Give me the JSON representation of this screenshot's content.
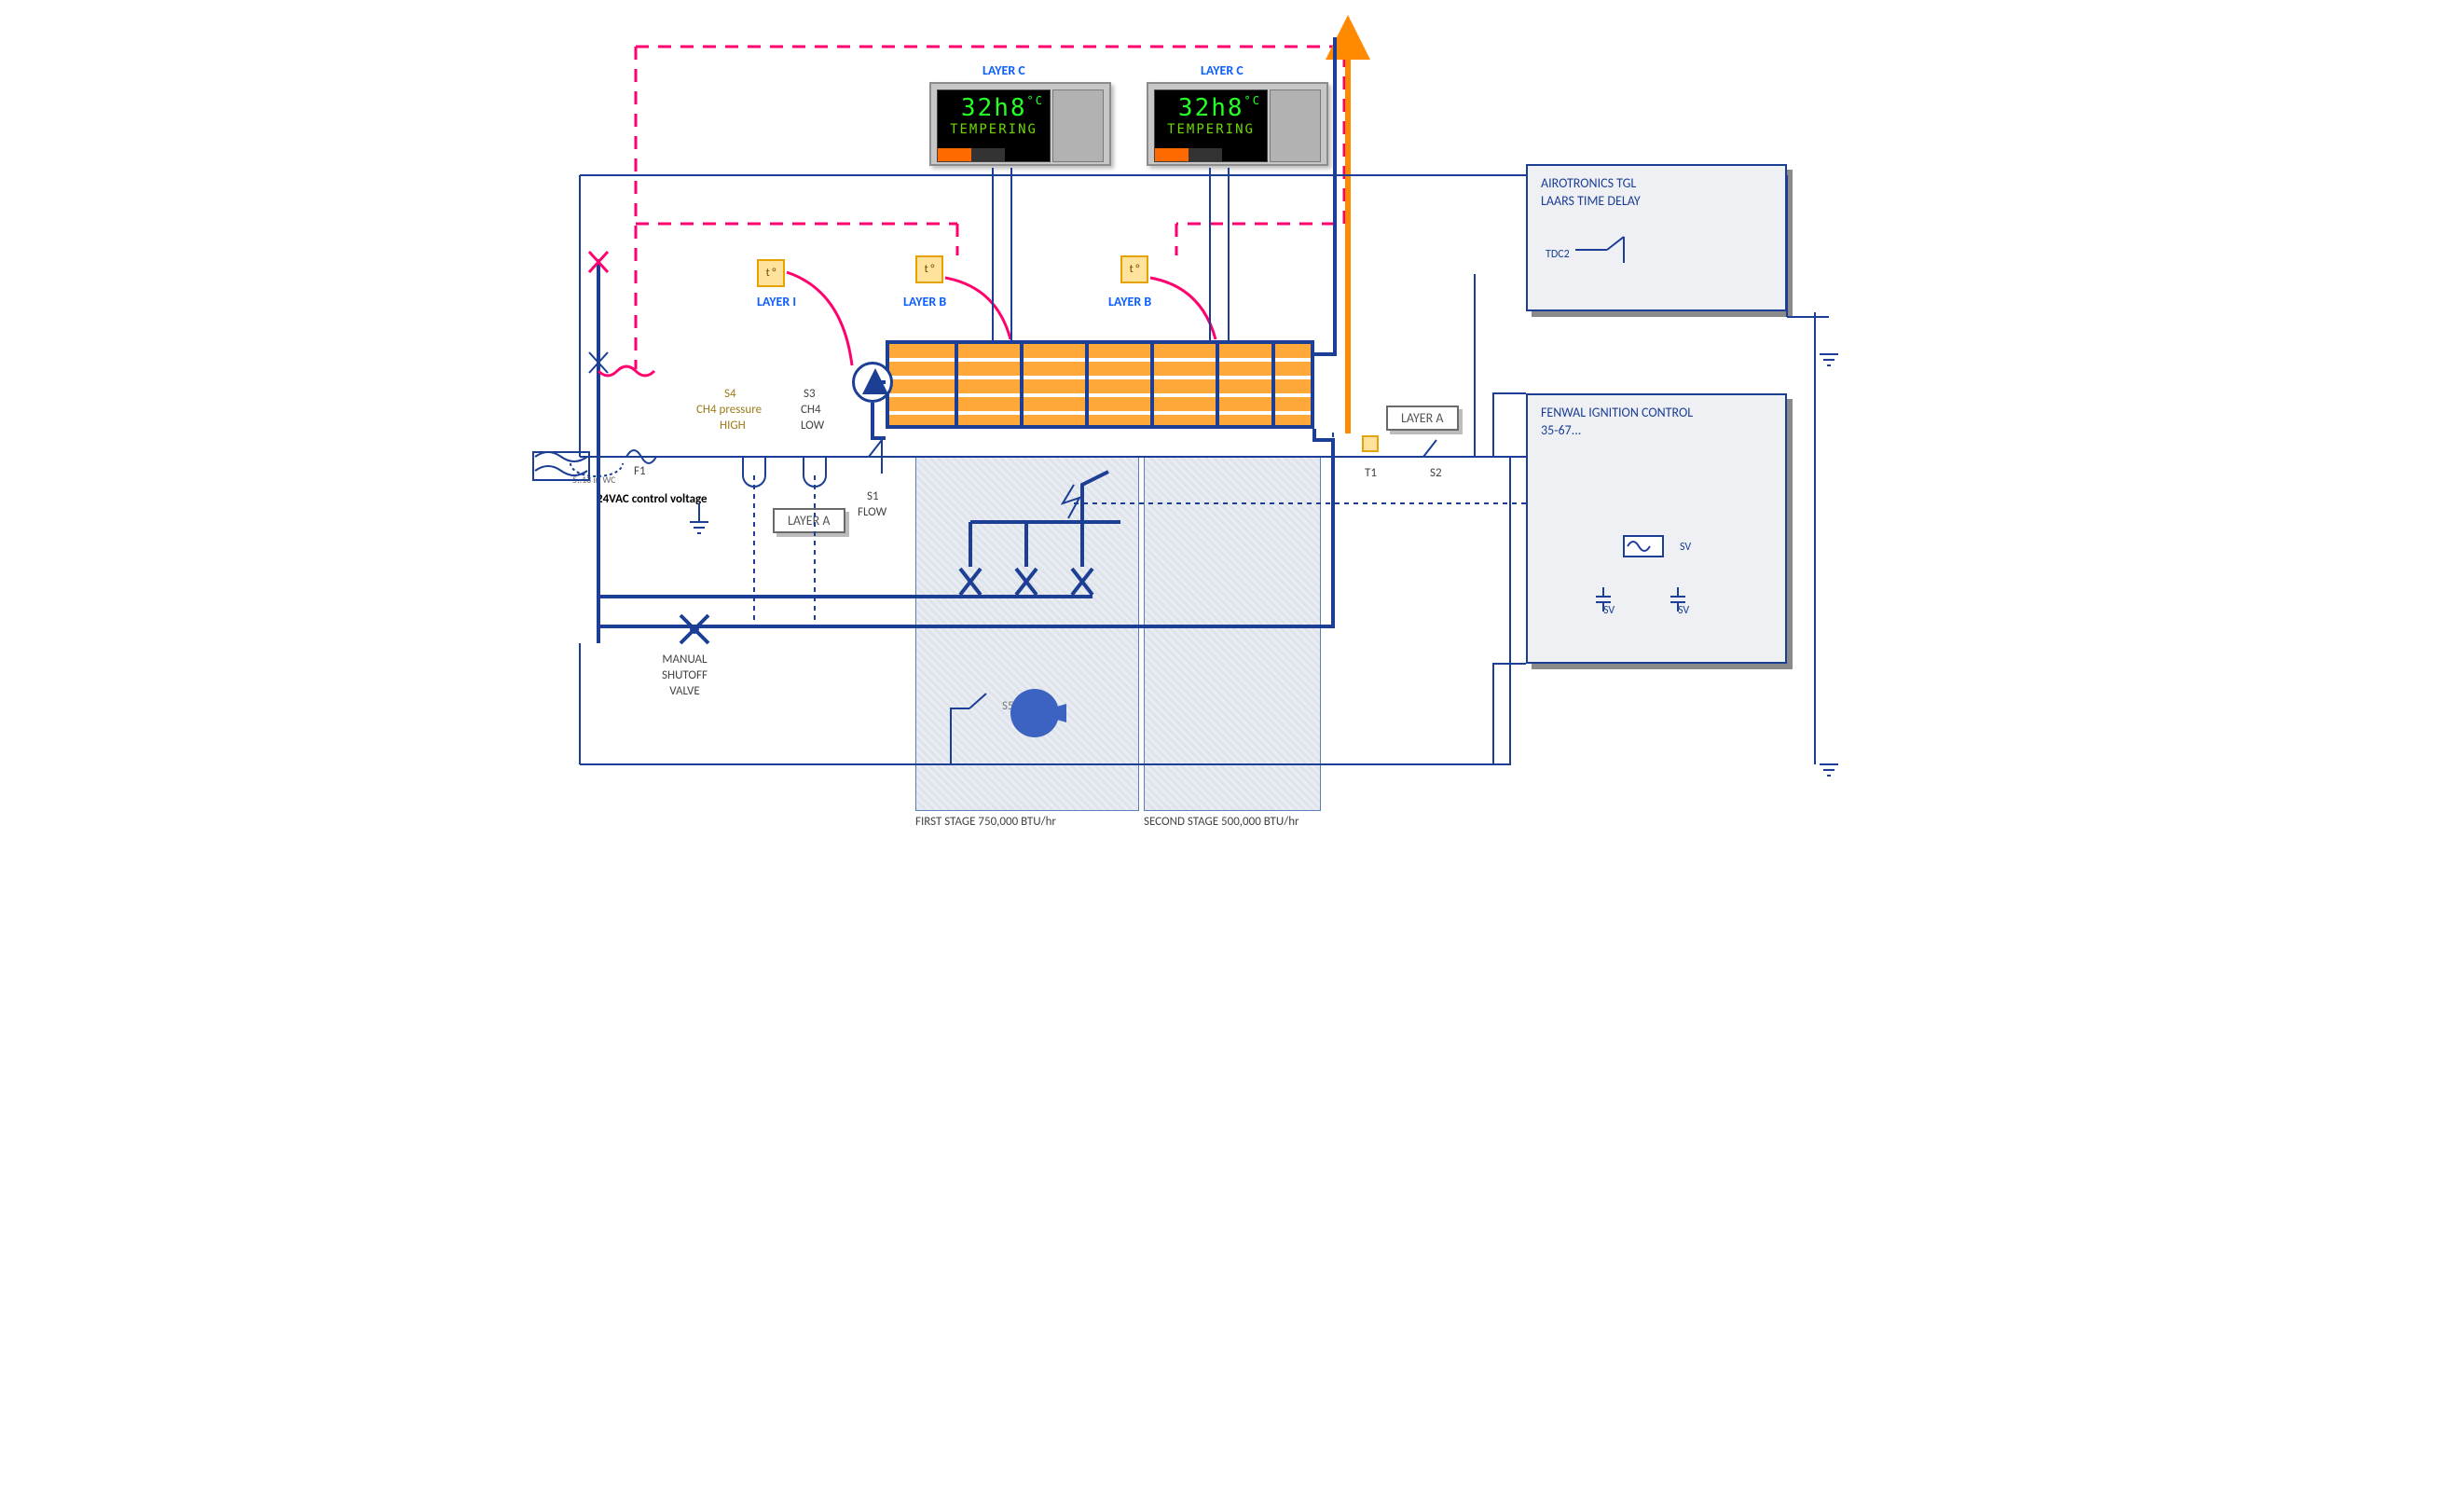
{
  "controllers": {
    "left": {
      "caption": "LAYER C",
      "top_line": "32h8",
      "unit": "°C",
      "bottom_line": "TEMPERING"
    },
    "right": {
      "caption": "LAYER C",
      "top_line": "32h8",
      "unit": "°C",
      "bottom_line": "TEMPERING"
    }
  },
  "sensors": {
    "I": {
      "glyph": "t °",
      "label": "LAYER I"
    },
    "B1": {
      "glyph": "t °",
      "label": "LAYER B"
    },
    "B2": {
      "glyph": "t °",
      "label": "LAYER B"
    }
  },
  "layerA_tags": {
    "left_box": "LAYER  A",
    "right_box": "LAYER  A"
  },
  "left_column": {
    "s4_title": "S4",
    "s4_line2": "CH4 pressure",
    "s4_line3": "HIGH",
    "s3_title": "S3",
    "s3_line2": "CH4",
    "s3_line3": "LOW",
    "fuse": "F1",
    "pressure_range": "5..13 in WC",
    "control_voltage": "24VAC control voltage",
    "s1": "S1",
    "s1_sub": "FLOW",
    "shutoff": "MANUAL\nSHUTOFF\nVALVE"
  },
  "right_blocks": {
    "airotronics": {
      "line1": "AIROTRONICS TGL",
      "line2": "LAARS  TIME DELAY",
      "tdc": "TDC2"
    },
    "fenwal": {
      "line1": "FENWAL IGNITION CONTROL",
      "line2": "35-67...",
      "sv": "SV"
    }
  },
  "mid_row": {
    "t1": "T1",
    "s2": "S2"
  },
  "stages": {
    "first": {
      "label": "FIRST STAGE   750,000 BTU/hr",
      "s5": "S5"
    },
    "second": {
      "label": "SECOND STAGE   500,000 BTU/hr"
    }
  }
}
